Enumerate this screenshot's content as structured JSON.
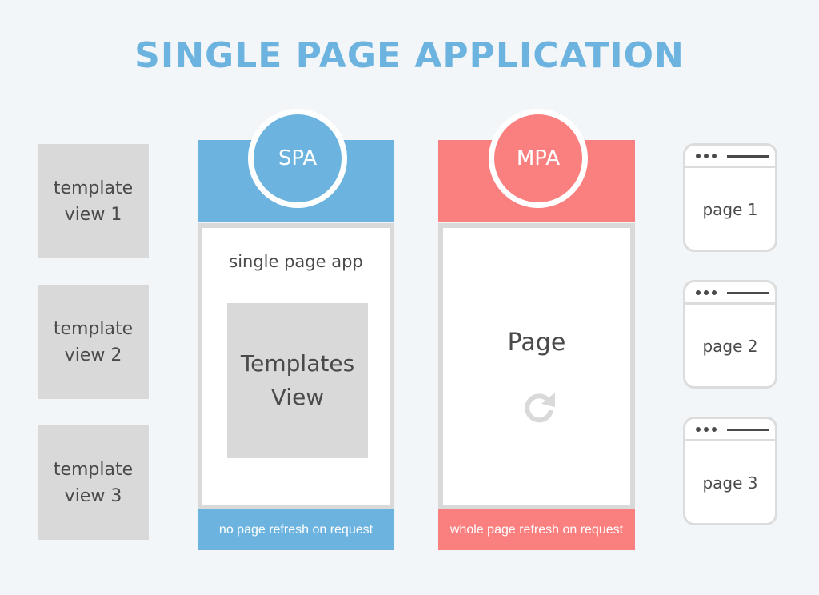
{
  "title": "SINGLE PAGE APPLICATION",
  "template_views": [
    {
      "line1": "template",
      "line2": "view 1"
    },
    {
      "line1": "template",
      "line2": "view 2"
    },
    {
      "line1": "template",
      "line2": "view 3"
    }
  ],
  "spa": {
    "badge": "SPA",
    "subtitle": "single page app",
    "inner_line1": "Templates",
    "inner_line2": "View",
    "footer": "no page refresh on request",
    "color": "#6cb4df"
  },
  "mpa": {
    "badge": "MPA",
    "page_label": "Page",
    "icon": "refresh-icon",
    "footer": "whole page refresh on request",
    "color": "#fa7f7f"
  },
  "pages": [
    {
      "label": "page 1"
    },
    {
      "label": "page 2"
    },
    {
      "label": "page 3"
    }
  ]
}
